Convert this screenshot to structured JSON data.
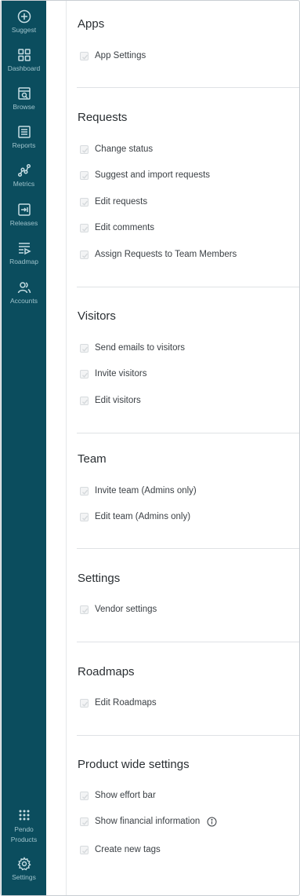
{
  "sidebar": {
    "top_items": [
      {
        "label": "Suggest",
        "icon": "plus-circle-icon"
      },
      {
        "label": "Dashboard",
        "icon": "grid-icon"
      },
      {
        "label": "Browse",
        "icon": "browse-icon"
      },
      {
        "label": "Reports",
        "icon": "reports-icon"
      },
      {
        "label": "Metrics",
        "icon": "metrics-icon"
      },
      {
        "label": "Releases",
        "icon": "releases-icon"
      },
      {
        "label": "Roadmap",
        "icon": "roadmap-icon"
      },
      {
        "label": "Accounts",
        "icon": "accounts-icon"
      }
    ],
    "bottom_items": [
      {
        "label": "Pendo Products",
        "icon": "dots-grid-icon"
      },
      {
        "label": "Settings",
        "icon": "gear-icon"
      }
    ]
  },
  "sections": {
    "apps": {
      "title": "Apps",
      "items": [
        "App Settings"
      ]
    },
    "requests": {
      "title": "Requests",
      "items": [
        "Change status",
        "Suggest and import requests",
        "Edit requests",
        "Edit comments",
        "Assign Requests to Team Members"
      ]
    },
    "visitors": {
      "title": "Visitors",
      "items": [
        "Send emails to visitors",
        "Invite visitors",
        "Edit visitors"
      ]
    },
    "team": {
      "title": "Team",
      "items": [
        "Invite team (Admins only)",
        "Edit team (Admins only)"
      ]
    },
    "settings": {
      "title": "Settings",
      "items": [
        "Vendor settings"
      ]
    },
    "roadmaps": {
      "title": "Roadmaps",
      "items": [
        "Edit Roadmaps"
      ]
    },
    "product_wide": {
      "title": "Product wide settings",
      "items": [
        "Show effort bar",
        "Show financial information",
        "Create new tags"
      ]
    }
  },
  "colors": {
    "sidebar_bg": "#0b4d5e",
    "sidebar_text": "#9fc3cc"
  }
}
